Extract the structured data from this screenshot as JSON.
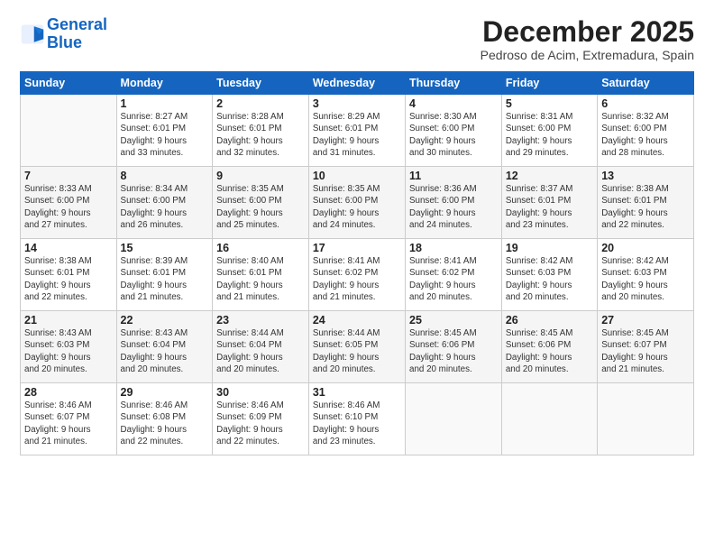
{
  "header": {
    "logo_line1": "General",
    "logo_line2": "Blue",
    "month": "December 2025",
    "location": "Pedroso de Acim, Extremadura, Spain"
  },
  "weekdays": [
    "Sunday",
    "Monday",
    "Tuesday",
    "Wednesday",
    "Thursday",
    "Friday",
    "Saturday"
  ],
  "weeks": [
    [
      {
        "day": "",
        "info": ""
      },
      {
        "day": "1",
        "info": "Sunrise: 8:27 AM\nSunset: 6:01 PM\nDaylight: 9 hours\nand 33 minutes."
      },
      {
        "day": "2",
        "info": "Sunrise: 8:28 AM\nSunset: 6:01 PM\nDaylight: 9 hours\nand 32 minutes."
      },
      {
        "day": "3",
        "info": "Sunrise: 8:29 AM\nSunset: 6:01 PM\nDaylight: 9 hours\nand 31 minutes."
      },
      {
        "day": "4",
        "info": "Sunrise: 8:30 AM\nSunset: 6:00 PM\nDaylight: 9 hours\nand 30 minutes."
      },
      {
        "day": "5",
        "info": "Sunrise: 8:31 AM\nSunset: 6:00 PM\nDaylight: 9 hours\nand 29 minutes."
      },
      {
        "day": "6",
        "info": "Sunrise: 8:32 AM\nSunset: 6:00 PM\nDaylight: 9 hours\nand 28 minutes."
      }
    ],
    [
      {
        "day": "7",
        "info": "Sunrise: 8:33 AM\nSunset: 6:00 PM\nDaylight: 9 hours\nand 27 minutes."
      },
      {
        "day": "8",
        "info": "Sunrise: 8:34 AM\nSunset: 6:00 PM\nDaylight: 9 hours\nand 26 minutes."
      },
      {
        "day": "9",
        "info": "Sunrise: 8:35 AM\nSunset: 6:00 PM\nDaylight: 9 hours\nand 25 minutes."
      },
      {
        "day": "10",
        "info": "Sunrise: 8:35 AM\nSunset: 6:00 PM\nDaylight: 9 hours\nand 24 minutes."
      },
      {
        "day": "11",
        "info": "Sunrise: 8:36 AM\nSunset: 6:00 PM\nDaylight: 9 hours\nand 24 minutes."
      },
      {
        "day": "12",
        "info": "Sunrise: 8:37 AM\nSunset: 6:01 PM\nDaylight: 9 hours\nand 23 minutes."
      },
      {
        "day": "13",
        "info": "Sunrise: 8:38 AM\nSunset: 6:01 PM\nDaylight: 9 hours\nand 22 minutes."
      }
    ],
    [
      {
        "day": "14",
        "info": "Sunrise: 8:38 AM\nSunset: 6:01 PM\nDaylight: 9 hours\nand 22 minutes."
      },
      {
        "day": "15",
        "info": "Sunrise: 8:39 AM\nSunset: 6:01 PM\nDaylight: 9 hours\nand 21 minutes."
      },
      {
        "day": "16",
        "info": "Sunrise: 8:40 AM\nSunset: 6:01 PM\nDaylight: 9 hours\nand 21 minutes."
      },
      {
        "day": "17",
        "info": "Sunrise: 8:41 AM\nSunset: 6:02 PM\nDaylight: 9 hours\nand 21 minutes."
      },
      {
        "day": "18",
        "info": "Sunrise: 8:41 AM\nSunset: 6:02 PM\nDaylight: 9 hours\nand 20 minutes."
      },
      {
        "day": "19",
        "info": "Sunrise: 8:42 AM\nSunset: 6:03 PM\nDaylight: 9 hours\nand 20 minutes."
      },
      {
        "day": "20",
        "info": "Sunrise: 8:42 AM\nSunset: 6:03 PM\nDaylight: 9 hours\nand 20 minutes."
      }
    ],
    [
      {
        "day": "21",
        "info": "Sunrise: 8:43 AM\nSunset: 6:03 PM\nDaylight: 9 hours\nand 20 minutes."
      },
      {
        "day": "22",
        "info": "Sunrise: 8:43 AM\nSunset: 6:04 PM\nDaylight: 9 hours\nand 20 minutes."
      },
      {
        "day": "23",
        "info": "Sunrise: 8:44 AM\nSunset: 6:04 PM\nDaylight: 9 hours\nand 20 minutes."
      },
      {
        "day": "24",
        "info": "Sunrise: 8:44 AM\nSunset: 6:05 PM\nDaylight: 9 hours\nand 20 minutes."
      },
      {
        "day": "25",
        "info": "Sunrise: 8:45 AM\nSunset: 6:06 PM\nDaylight: 9 hours\nand 20 minutes."
      },
      {
        "day": "26",
        "info": "Sunrise: 8:45 AM\nSunset: 6:06 PM\nDaylight: 9 hours\nand 20 minutes."
      },
      {
        "day": "27",
        "info": "Sunrise: 8:45 AM\nSunset: 6:07 PM\nDaylight: 9 hours\nand 21 minutes."
      }
    ],
    [
      {
        "day": "28",
        "info": "Sunrise: 8:46 AM\nSunset: 6:07 PM\nDaylight: 9 hours\nand 21 minutes."
      },
      {
        "day": "29",
        "info": "Sunrise: 8:46 AM\nSunset: 6:08 PM\nDaylight: 9 hours\nand 22 minutes."
      },
      {
        "day": "30",
        "info": "Sunrise: 8:46 AM\nSunset: 6:09 PM\nDaylight: 9 hours\nand 22 minutes."
      },
      {
        "day": "31",
        "info": "Sunrise: 8:46 AM\nSunset: 6:10 PM\nDaylight: 9 hours\nand 23 minutes."
      },
      {
        "day": "",
        "info": ""
      },
      {
        "day": "",
        "info": ""
      },
      {
        "day": "",
        "info": ""
      }
    ]
  ]
}
